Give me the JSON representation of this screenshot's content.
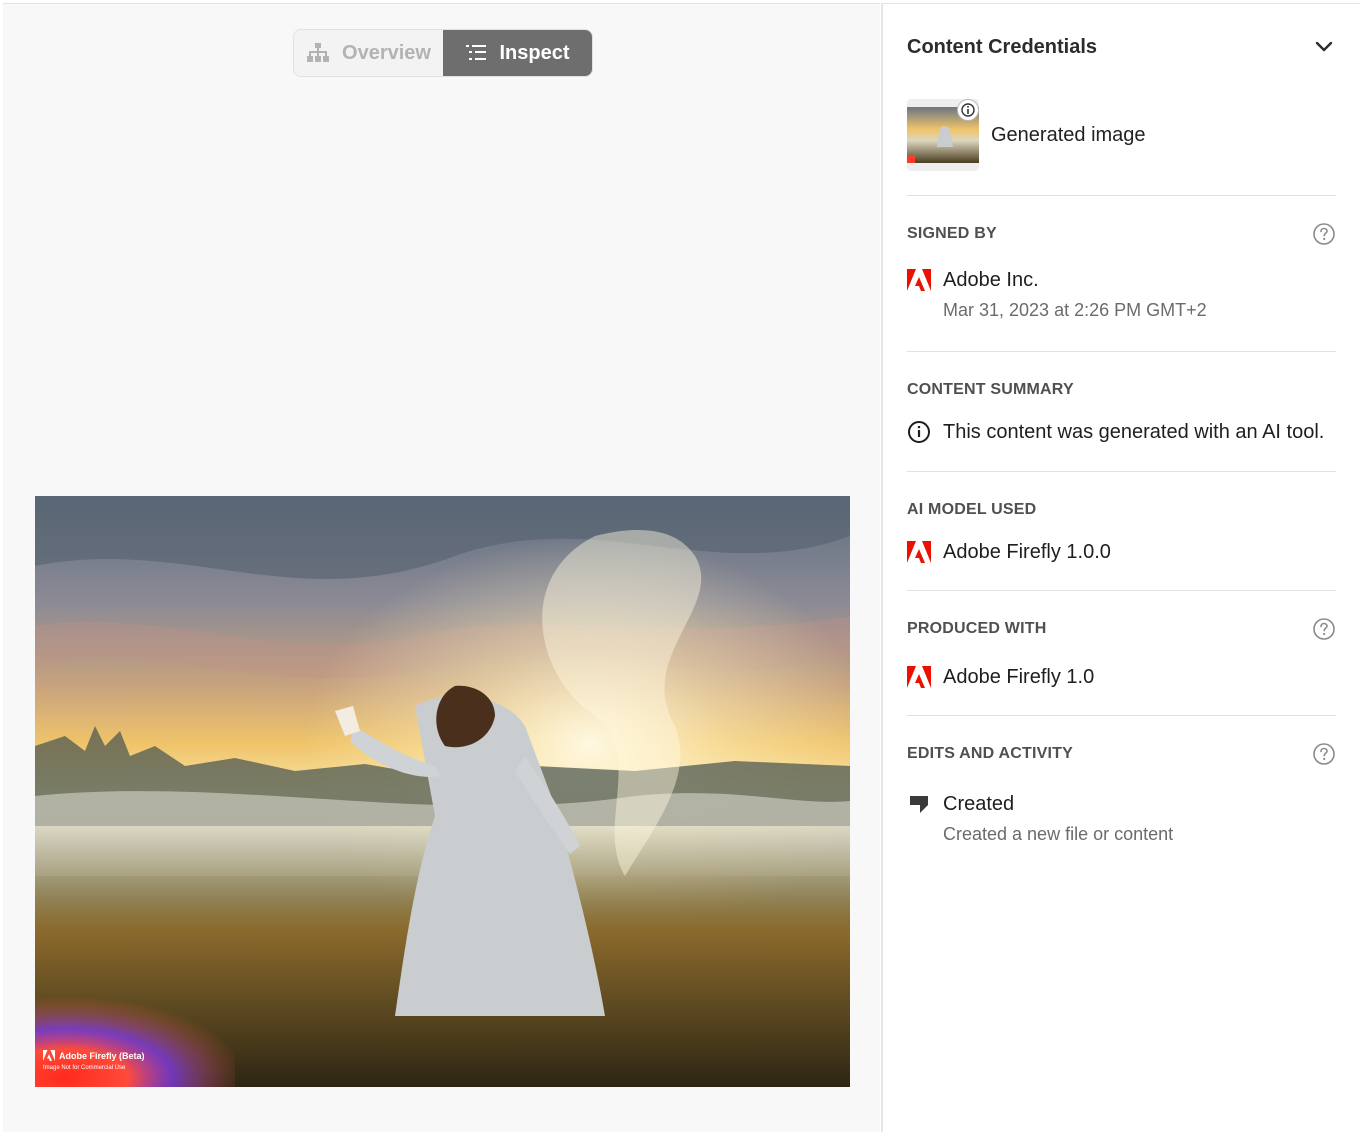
{
  "toggle": {
    "overview_label": "Overview",
    "inspect_label": "Inspect",
    "active": "Inspect"
  },
  "image": {
    "watermark_title": "Adobe Firefly (Beta)",
    "watermark_sub": "Image Not for Commercial Use"
  },
  "panel": {
    "title": "Content Credentials",
    "asset_label": "Generated image",
    "signed_by": {
      "label": "SIGNED BY",
      "name": "Adobe Inc.",
      "date": "Mar 31, 2023 at 2:26 PM GMT+2"
    },
    "content_summary": {
      "label": "CONTENT SUMMARY",
      "text": "This content was generated with an AI tool."
    },
    "ai_model": {
      "label": "AI MODEL USED",
      "name": "Adobe Firefly 1.0.0"
    },
    "produced_with": {
      "label": "PRODUCED WITH",
      "name": "Adobe Firefly 1.0"
    },
    "edits": {
      "label": "EDITS AND ACTIVITY",
      "action": "Created",
      "description": "Created a new file or content"
    }
  },
  "colors": {
    "adobe_red": "#eb1000",
    "toggle_active": "#6e6e6e"
  }
}
